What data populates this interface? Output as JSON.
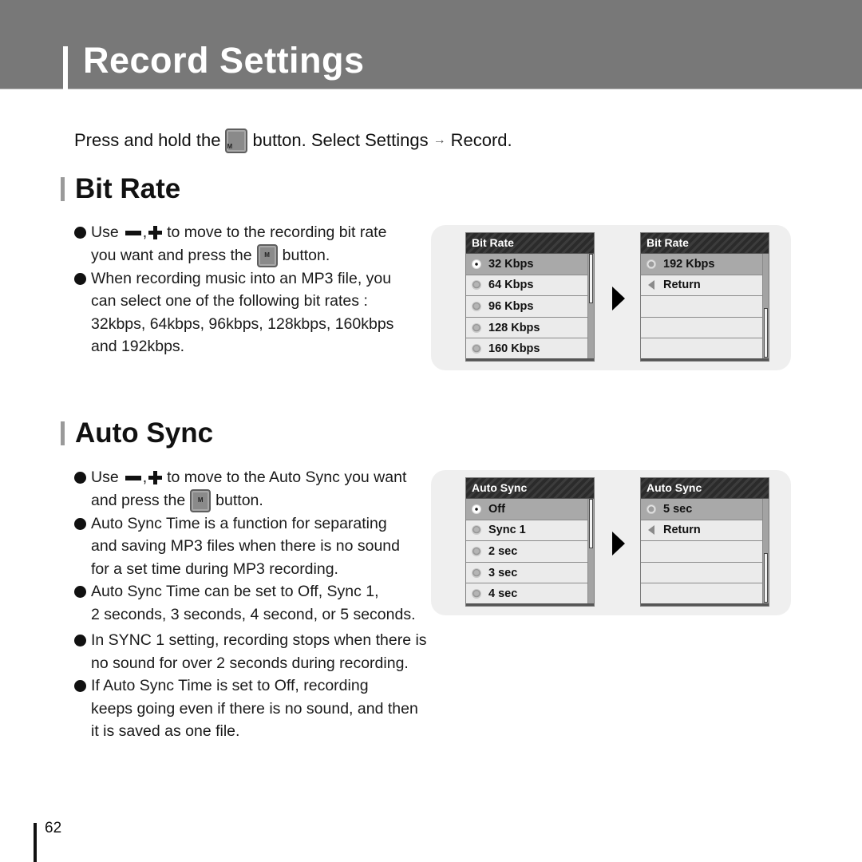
{
  "header": {
    "title": "Record Settings"
  },
  "instruction": {
    "prefix": "Press and hold the",
    "button_label": "M",
    "suffix": "button. Select Settings",
    "arrow": "→",
    "target": "Record."
  },
  "bit_rate": {
    "heading": "Bit Rate",
    "bullets": [
      {
        "lines": [
          "Use",
          "to move to the recording bit rate",
          "you want and press the",
          "button."
        ]
      },
      {
        "lines": [
          "When recording music into an MP3 file, you",
          "can select one of the following bit rates :",
          "32kbps, 64kbps, 96kbps, 128kbps, 160kbps",
          "and 192kbps."
        ]
      }
    ],
    "screen_left": {
      "title": "Bit Rate",
      "items": [
        "32 Kbps",
        "64 Kbps",
        "96 Kbps",
        "128 Kbps",
        "160 Kbps"
      ],
      "selected_index": 0
    },
    "screen_right": {
      "title": "Bit Rate",
      "items": [
        "192 Kbps",
        "Return",
        "",
        "",
        ""
      ],
      "highlighted_index": 0
    }
  },
  "auto_sync": {
    "heading": "Auto Sync",
    "bullets": [
      {
        "lines": [
          "Use",
          "to move to the Auto Sync you want",
          "and press the",
          "button."
        ]
      },
      {
        "lines": [
          "Auto Sync Time is a function for separating",
          "and saving MP3 files when there is no sound",
          "for a set time during MP3 recording."
        ]
      },
      {
        "lines": [
          "Auto Sync Time can be set to Off, Sync 1,",
          "2 seconds, 3 seconds, 4 second, or 5 seconds."
        ]
      },
      {
        "lines": [
          "In SYNC 1 setting, recording stops when there is",
          "no sound for over 2 seconds during recording."
        ]
      },
      {
        "lines": [
          "If Auto Sync Time is set to Off, recording",
          "keeps going even if there is no sound, and then",
          "it is saved as one file."
        ]
      }
    ],
    "screen_left": {
      "title": "Auto Sync",
      "items": [
        "Off",
        "Sync 1",
        "2 sec",
        "3 sec",
        "4 sec"
      ],
      "selected_index": 0
    },
    "screen_right": {
      "title": "Auto Sync",
      "items": [
        "5 sec",
        "Return",
        "",
        "",
        ""
      ],
      "highlighted_index": 0
    }
  },
  "button_label": "M",
  "icons": {
    "minus": "minus-icon",
    "plus": "plus-icon",
    "next": "right-triangle-icon",
    "return": "return-arrow-icon",
    "radio": "radio-icon"
  },
  "page_number": "62"
}
